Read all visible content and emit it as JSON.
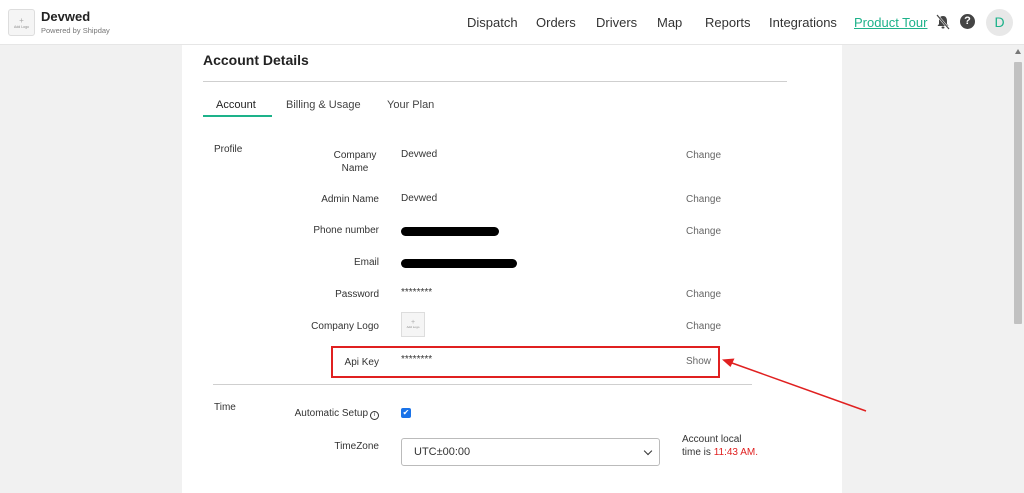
{
  "header": {
    "logo_text": "Add Logo",
    "brand_name": "Devwed",
    "brand_sub": "Powered by Shipday",
    "nav": [
      {
        "label": "Dispatch"
      },
      {
        "label": "Orders"
      },
      {
        "label": "Drivers"
      },
      {
        "label": "Map"
      },
      {
        "label": "Reports"
      },
      {
        "label": "Integrations"
      },
      {
        "label": "Product Tour"
      }
    ],
    "help_glyph": "?",
    "avatar_initial": "D"
  },
  "page": {
    "title": "Account Details",
    "tabs": [
      {
        "label": "Account",
        "active": true
      },
      {
        "label": "Billing & Usage",
        "active": false
      },
      {
        "label": "Your Plan",
        "active": false
      }
    ]
  },
  "profile": {
    "section_label": "Profile",
    "fields": {
      "company_name": {
        "label": "Company Name",
        "value": "Devwed",
        "action": "Change"
      },
      "admin_name": {
        "label": "Admin Name",
        "value": "Devwed",
        "action": "Change"
      },
      "phone": {
        "label": "Phone number",
        "action": "Change"
      },
      "email": {
        "label": "Email"
      },
      "password": {
        "label": "Password",
        "value": "********",
        "action": "Change"
      },
      "company_logo": {
        "label": "Company Logo",
        "logo_text": "Add Logo",
        "action": "Change"
      },
      "api_key": {
        "label": "Api Key",
        "value": "********",
        "action": "Show"
      }
    }
  },
  "time": {
    "section_label": "Time",
    "automatic_setup": {
      "label": "Automatic Setup",
      "checked": true,
      "check_glyph": "✔",
      "info_glyph": "i"
    },
    "timezone": {
      "label": "TimeZone",
      "value": "UTC±00:00"
    },
    "local_time": {
      "prefix": "Account local time is",
      "time": "11:43 AM."
    }
  },
  "colors": {
    "accent": "#1db28a",
    "annotation": "#e02020",
    "checkbox": "#1a73e8"
  },
  "icons": {
    "bell": "bell-muted-icon",
    "help": "help-circle-icon",
    "info": "info-icon",
    "chevron": "chevron-down-icon"
  }
}
